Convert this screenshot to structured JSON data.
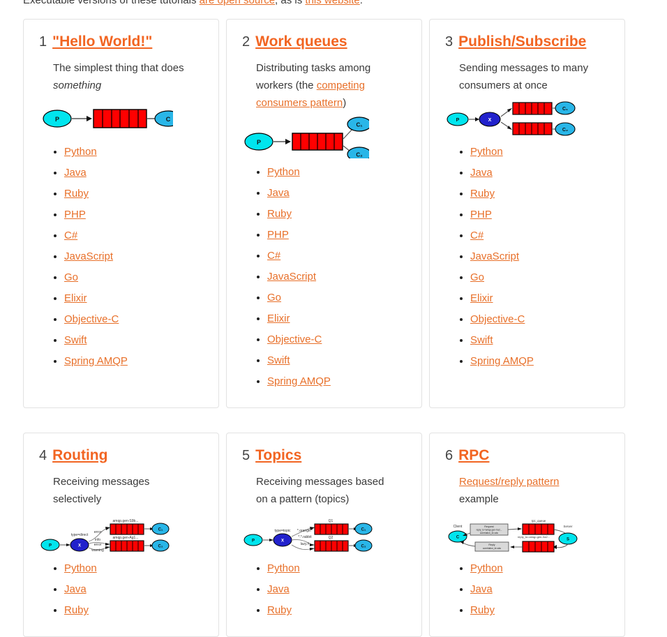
{
  "intro": {
    "text_before": "Executable versions of these tutorials ",
    "link1": "are open source",
    "text_middle": ", as is ",
    "link2": "this website",
    "text_after": "."
  },
  "languages": [
    "Python",
    "Java",
    "Ruby",
    "PHP",
    "C#",
    "JavaScript",
    "Go",
    "Elixir",
    "Objective-C",
    "Swift",
    "Spring AMQP"
  ],
  "languages_short": [
    "Python",
    "Java",
    "Ruby"
  ],
  "colors": {
    "link": "#e8702a",
    "heading": "#f26522",
    "text": "#3a3a3a",
    "card_border": "#e2e2e2",
    "producer": "#00e5ee",
    "consumer": "#29b6e8",
    "exchange": "#2222cc",
    "queue": "#ff0000",
    "box": "#d9d9d9"
  },
  "tutorials": [
    {
      "number": "1",
      "title": "\"Hello World!\"",
      "desc_plain": "The simplest thing that does ",
      "desc_em": "something",
      "diagram": {
        "type": "hello-world",
        "nodes": [
          "P",
          "C"
        ],
        "queue_segments": 6
      }
    },
    {
      "number": "2",
      "title": "Work queues",
      "desc_plain": "Distributing tasks among workers (the ",
      "desc_link": "competing consumers pattern",
      "desc_tail": ")",
      "diagram": {
        "type": "work-queues",
        "nodes": [
          "P",
          "C₁",
          "C₂"
        ],
        "queue_segments": 6
      }
    },
    {
      "number": "3",
      "title": "Publish/Subscribe",
      "desc_plain": "Sending messages to many consumers at once",
      "diagram": {
        "type": "pub-sub",
        "nodes": [
          "P",
          "X",
          "C₁",
          "C₂"
        ],
        "queue_segments": 6
      }
    },
    {
      "number": "4",
      "title": "Routing",
      "desc_plain": "Receiving messages selectively",
      "diagram": {
        "type": "routing",
        "nodes": [
          "P",
          "X",
          "C₁",
          "C₂"
        ],
        "exchange_label": "type=direct",
        "binding_keys": [
          "error",
          "info",
          "error",
          "warning"
        ],
        "queue_names": [
          "amqp.gen-S9b...",
          "amqp.gen-Ag1..."
        ],
        "queue_segments": 6
      }
    },
    {
      "number": "5",
      "title": "Topics",
      "desc_plain": "Receiving messages based on a pattern (topics)",
      "diagram": {
        "type": "topics",
        "nodes": [
          "P",
          "X",
          "C₁",
          "C₂"
        ],
        "exchange_label": "type=topic",
        "binding_keys": [
          "*.orange.*",
          "*.*.rabbit",
          "lazy.#"
        ],
        "queue_names": [
          "Q1",
          "Q2"
        ],
        "queue_segments": 6
      }
    },
    {
      "number": "6",
      "title": "RPC",
      "desc_link": "Request/reply pattern",
      "desc_tail": " example",
      "diagram": {
        "type": "rpc",
        "nodes": [
          "Client",
          "Server"
        ],
        "queue_names": [
          "rpc_queue",
          "reply_to=amqp.gen-Xa2..."
        ],
        "messages": [
          "Request reply_to=amqp.gen-Xa2... correlation_id=abc",
          "Reply correlation_id=abc"
        ],
        "queue_segments": 5
      }
    }
  ]
}
